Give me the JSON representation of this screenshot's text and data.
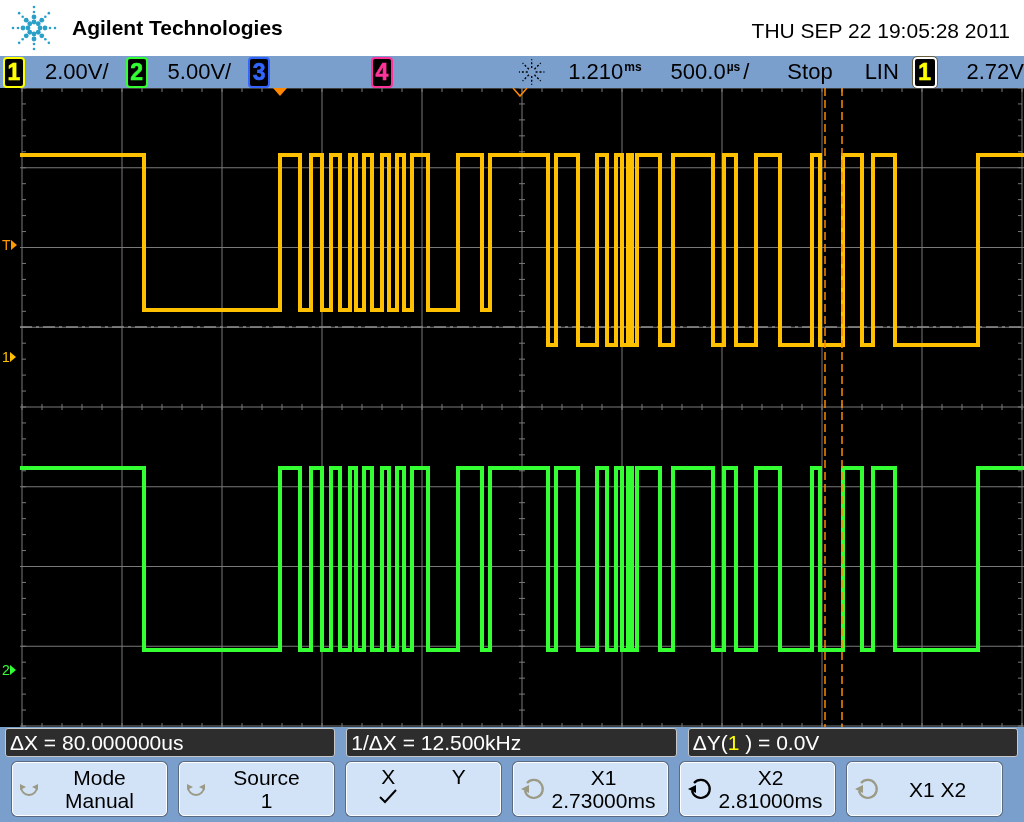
{
  "header": {
    "brand": "Agilent Technologies",
    "datetime": "THU SEP 22 19:05:28 2011"
  },
  "status_bar": {
    "channels": [
      {
        "number": "1",
        "color": "#ffff00",
        "scale": "2.00V/"
      },
      {
        "number": "2",
        "color": "#33ff33",
        "scale": "5.00V/"
      },
      {
        "number": "3",
        "color": "#3366ff"
      },
      {
        "number": "4",
        "color": "#ff3399"
      }
    ],
    "delay": {
      "value": "1.210",
      "unit": "ms"
    },
    "timebase": {
      "value": "500.0",
      "unit": "µs",
      "suffix": "/"
    },
    "run_state": "Stop",
    "trigger": {
      "coupling": "LIN",
      "source": {
        "number": "1",
        "color": "#ffff00"
      },
      "level": "2.72V"
    }
  },
  "markers": [
    {
      "label": "T",
      "color": "#ff9900"
    },
    {
      "label": "1",
      "color": "#ffc000"
    },
    {
      "label": "2",
      "color": "#33ff33"
    }
  ],
  "traces": [
    {
      "color": "#ffc000"
    },
    {
      "color": "#33ff33"
    }
  ],
  "readouts": [
    {
      "text": "ΔX = 80.000000us"
    },
    {
      "text": "1/ΔX = 12.500kHz"
    },
    {
      "prefix": "ΔY(",
      "channel": {
        "number": "1",
        "color": "#ffff00"
      },
      "suffix": " ) = 0.0V"
    }
  ],
  "softkeys": [
    {
      "kind": "push_knob",
      "active": false,
      "label": "Mode",
      "value": "Manual"
    },
    {
      "kind": "push_knob",
      "active": false,
      "label": "Source",
      "value": "1"
    },
    {
      "kind": "toggle",
      "options": [
        {
          "label": "X",
          "selected": true
        },
        {
          "label": "Y",
          "selected": false
        }
      ]
    },
    {
      "kind": "rotate_knob",
      "active": false,
      "label": "X1",
      "value": "2.73000ms"
    },
    {
      "kind": "rotate_knob",
      "active": true,
      "label": "X2",
      "value": "2.81000ms"
    },
    {
      "kind": "rotate_knob",
      "active": false,
      "label": "X1 X2"
    }
  ]
}
